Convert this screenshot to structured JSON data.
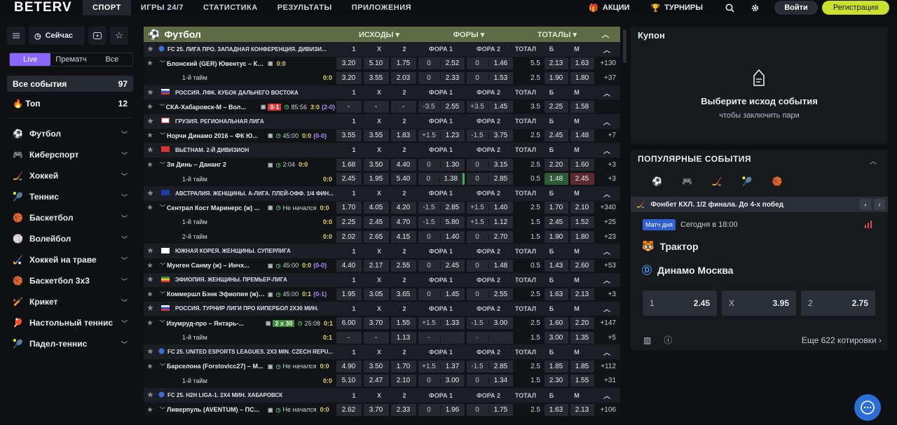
{
  "logo": "BETERV",
  "nav": [
    "СПОРТ",
    "ИГРЫ 24/7",
    "СТАТИСТИКА",
    "РЕЗУЛЬТАТЫ",
    "ПРИЛОЖЕНИЯ"
  ],
  "actions": "АКЦИИ",
  "tournaments": "ТУРНИРЫ",
  "login": "Войти",
  "register": "Регистрация",
  "now": "Сейчас",
  "tabs": [
    "Live",
    "Прематч",
    "Все"
  ],
  "all_events": {
    "label": "Все события",
    "count": "97"
  },
  "top": {
    "label": "Топ",
    "count": "12"
  },
  "sports": [
    "Футбол",
    "Киберспорт",
    "Хоккей",
    "Теннис",
    "Баскетбол",
    "Волейбол",
    "Хоккей на траве",
    "Баскетбол 3х3",
    "Крикет",
    "Настольный теннис",
    "Падел-теннис"
  ],
  "main_header": {
    "title": "Футбол",
    "outcomes": "ИСХОДЫ",
    "handicaps": "ФОРЫ",
    "totals": "ТОТАЛЫ"
  },
  "colhdr": [
    "1",
    "X",
    "2",
    "ФОРА 1",
    "ФОРА 2",
    "ТОТАЛ",
    "Б",
    "М"
  ],
  "rows": [
    {
      "t": "lg",
      "name": "FC 25. ЛИГА ПРО. ЗАПАДНАЯ КОНФЕРЕНЦИЯ. ДИВИЗИ...",
      "flag": "globe"
    },
    {
      "t": "ev",
      "name": "Блонский (GER) Ювентус – Кавраk (VVS)...",
      "tm": "",
      "sc": "0:0",
      "sc2": "",
      "o": [
        "3.20",
        "5.10",
        "1.75"
      ],
      "f1": [
        "0",
        "2.52"
      ],
      "f2": [
        "0",
        "1.46"
      ],
      "tot": "5.5",
      "b": "2.13",
      "m": "1.63",
      "more": "+130"
    },
    {
      "t": "sub",
      "name": "1-й тайм",
      "sc": "0:0",
      "o": [
        "3.20",
        "3.55",
        "2.03"
      ],
      "f1": [
        "0",
        "2.33"
      ],
      "f2": [
        "0",
        "1.53"
      ],
      "tot": "2.5",
      "b": "1.90",
      "m": "1.80",
      "more": "+37"
    },
    {
      "t": "lg",
      "name": "РОССИЯ. ЛФК. КУБОК ДАЛЬНЕГО ВОСТОКА",
      "flag": "ru"
    },
    {
      "t": "ev",
      "name": "СКА-Хабаровск-М – Вол...",
      "red": "0-1",
      "tm": "85:56",
      "sc": "3:0",
      "sc2": "(2-0)",
      "o": [
        "-",
        "-",
        "-"
      ],
      "f1": [
        "-3.5",
        "2.55"
      ],
      "f2": [
        "+3.5",
        "1.45"
      ],
      "tot": "3.5",
      "b": "2.25",
      "m": "1.58",
      "more": ""
    },
    {
      "t": "lg",
      "name": "ГРУЗИЯ. РЕГИОНАЛЬНАЯ ЛИГА",
      "flag": "ge"
    },
    {
      "t": "ev",
      "name": "Норчи Динамо 2016 – ФК Ю...",
      "tm": "45:00",
      "sc": "0:0",
      "sc2": "(0-0)",
      "o": [
        "3.55",
        "3.55",
        "1.83"
      ],
      "f1": [
        "+1.5",
        "1.23"
      ],
      "f2": [
        "-1.5",
        "3.75"
      ],
      "tot": "2.5",
      "b": "2.45",
      "m": "1.48",
      "more": "+7"
    },
    {
      "t": "lg",
      "name": "ВЬЕТНАМ. 2-Й ДИВИЗИОН",
      "flag": "vn"
    },
    {
      "t": "ev",
      "name": "Зя Динь – Дананг 2",
      "tm": "2:04",
      "sc": "0:0",
      "sc2": "",
      "o": [
        "1.68",
        "3.50",
        "4.40"
      ],
      "f1": [
        "0",
        "1.30"
      ],
      "f2": [
        "0",
        "3.15"
      ],
      "tot": "2.5",
      "b": "2.20",
      "m": "1.60",
      "more": "+3"
    },
    {
      "t": "sub",
      "name": "1-й тайм",
      "sc": "0:0",
      "o": [
        "2.45",
        "1.95",
        "5.40"
      ],
      "f1": [
        "0",
        "1.38"
      ],
      "f2": [
        "0",
        "2.85"
      ],
      "tot": "0.5",
      "b": "1.48",
      "m": "2.45",
      "more": "+3"
    },
    {
      "t": "lg",
      "name": "АВСТРАЛИЯ. ЖЕНЩИНЫ. А-ЛИГА. ПЛЕЙ-ОФФ. 1/4 ФИН...",
      "flag": "au"
    },
    {
      "t": "ev",
      "name": "Сентрал Кост Маринерс (ж) ...",
      "tm": "Не начался",
      "sc": "0:0",
      "sc2": "",
      "o": [
        "1.70",
        "4.05",
        "4.20"
      ],
      "f1": [
        "-1.5",
        "2.85"
      ],
      "f2": [
        "+1.5",
        "1.40"
      ],
      "tot": "2.5",
      "b": "1.70",
      "m": "2.10",
      "more": "+340"
    },
    {
      "t": "sub",
      "name": "1-й тайм",
      "sc": "0:0",
      "o": [
        "2.25",
        "2.45",
        "4.70"
      ],
      "f1": [
        "-1.5",
        "5.80"
      ],
      "f2": [
        "+1.5",
        "1.12"
      ],
      "tot": "1.5",
      "b": "2.45",
      "m": "1.52",
      "more": "+25"
    },
    {
      "t": "sub",
      "name": "2-й тайм",
      "sc": "0:0",
      "o": [
        "2.02",
        "2.65",
        "4.15"
      ],
      "f1": [
        "0",
        "1.40"
      ],
      "f2": [
        "0",
        "2.70"
      ],
      "tot": "1.5",
      "b": "1.90",
      "m": "1.80",
      "more": "+23"
    },
    {
      "t": "lg",
      "name": "ЮЖНАЯ КОРЕЯ. ЖЕНЩИНЫ. СУПЕРЛИГА",
      "flag": "kr"
    },
    {
      "t": "ev",
      "name": "Мунген Санму (ж) – Инчх...",
      "tm": "45:00",
      "sc": "0:0",
      "sc2": "(0-0)",
      "o": [
        "4.40",
        "2.17",
        "2.55"
      ],
      "f1": [
        "0",
        "2.45"
      ],
      "f2": [
        "0",
        "1.48"
      ],
      "tot": "0.5",
      "b": "1.43",
      "m": "2.60",
      "more": "+53"
    },
    {
      "t": "lg",
      "name": "ЭФИОПИЯ. ЖЕНЩИНЫ. ПРЕМЬЕР-ЛИГА",
      "flag": "et"
    },
    {
      "t": "ev",
      "name": "Коммершл Бэнк Эфиопия (ж) ...",
      "tm": "45:00",
      "sc": "0:1",
      "sc2": "(0-1)",
      "o": [
        "1.95",
        "3.05",
        "3.65"
      ],
      "f1": [
        "0",
        "1.45"
      ],
      "f2": [
        "0",
        "2.55"
      ],
      "tot": "2.5",
      "b": "1.63",
      "m": "2.13",
      "more": "+3"
    },
    {
      "t": "lg",
      "name": "РОССИЯ. ТУРНИР ЛИГИ ПРО КИПЕРБОЛ 2Х30 МИН.",
      "flag": "ru"
    },
    {
      "t": "ev",
      "name": "Изумруд-про – Янтарь-...",
      "green": "2 x 30",
      "tm": "25:08",
      "sc": "0:1",
      "sc2": "",
      "o": [
        "6.00",
        "3.70",
        "1.55"
      ],
      "f1": [
        "+1.5",
        "1.33"
      ],
      "f2": [
        "-1.5",
        "3.00"
      ],
      "tot": "2.5",
      "b": "1.60",
      "m": "2.20",
      "more": "+147"
    },
    {
      "t": "sub",
      "name": "1-й тайм",
      "sc": "0:1",
      "o": [
        "-",
        "-",
        "1.13"
      ],
      "f1": [
        "-",
        ""
      ],
      "f2": [
        "-",
        ""
      ],
      "tot": "1.5",
      "b": "3.00",
      "m": "1.35",
      "more": "+5"
    },
    {
      "t": "lg",
      "name": "FC 25. UNITED ESPORTS LEAGUES. 2X3 MIN. CZECH REPU...",
      "flag": "globe"
    },
    {
      "t": "ev",
      "name": "Барселона (Forstovicc27) – M...",
      "tm": "Не начался",
      "sc": "0:0",
      "sc2": "",
      "o": [
        "4.90",
        "3.50",
        "1.70"
      ],
      "f1": [
        "+1.5",
        "1.37"
      ],
      "f2": [
        "-1.5",
        "2.85"
      ],
      "tot": "2.5",
      "b": "1.85",
      "m": "1.85",
      "more": "+112"
    },
    {
      "t": "sub",
      "name": "1-й тайм",
      "sc": "0:0",
      "o": [
        "5.10",
        "2.47",
        "2.10"
      ],
      "f1": [
        "0",
        "3.00"
      ],
      "f2": [
        "0",
        "1.34"
      ],
      "tot": "1.5",
      "b": "2.30",
      "m": "1.55",
      "more": "+31"
    },
    {
      "t": "lg",
      "name": "FC 25. H2H LIGA-1. 2Х4 МИН. ХАБАРОВСК",
      "flag": "globe"
    },
    {
      "t": "ev",
      "name": "Ливерпуль (AVENTUM) – ПС...",
      "tm": "Не начался",
      "sc": "0:0",
      "sc2": "",
      "o": [
        "2.62",
        "3.70",
        "2.33"
      ],
      "f1": [
        "0",
        "1.96"
      ],
      "f2": [
        "0",
        "1.75"
      ],
      "tot": "2.5",
      "b": "1.63",
      "m": "2.13",
      "more": "+106"
    }
  ],
  "coupon": {
    "title": "Купон",
    "line1": "Выберите исход события",
    "line2": "чтобы заключить пари"
  },
  "popular": {
    "title": "ПОПУЛЯРНЫЕ СОБЫТИЯ",
    "league": "Фонбет КХЛ. 1/2 финала. До 4-х побед",
    "badge": "Матч дня",
    "time": "Сегодня в 18:00",
    "team1": "Трактор",
    "team2": "Динамо Москва",
    "odds": [
      {
        "l": "1",
        "v": "2.45"
      },
      {
        "l": "X",
        "v": "3.95"
      },
      {
        "l": "2",
        "v": "2.75"
      }
    ],
    "more": "Еще 622 котировки"
  }
}
